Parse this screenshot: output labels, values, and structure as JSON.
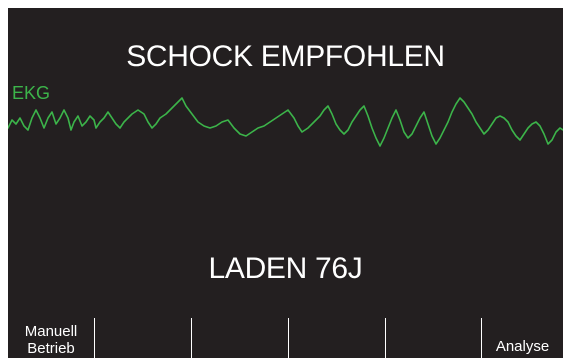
{
  "status": {
    "message": "SCHOCK EMPFOHLEN",
    "charge": "LADEN 76J"
  },
  "ecg": {
    "label": "EKG",
    "color": "#3cb44a",
    "rhythm": "ventricular fibrillation"
  },
  "softkeys": {
    "key1_line1": "Manuell",
    "key1_line2": "Betrieb",
    "key6": "Analyse"
  },
  "colors": {
    "background": "#231f20",
    "text": "#ffffff",
    "trace": "#3cb44a"
  }
}
